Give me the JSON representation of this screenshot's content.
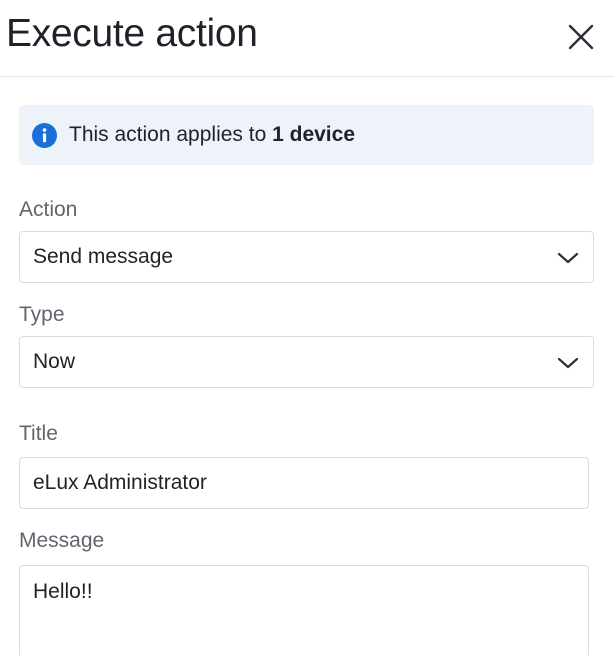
{
  "dialog": {
    "title": "Execute action",
    "close_icon": "close-icon"
  },
  "info_banner": {
    "icon": "info-icon",
    "text_prefix": "This action applies to ",
    "text_bold": "1 device"
  },
  "form": {
    "action": {
      "label": "Action",
      "value": "Send message"
    },
    "type": {
      "label": "Type",
      "value": "Now"
    },
    "title_field": {
      "label": "Title",
      "value": "eLux Administrator"
    },
    "message": {
      "label": "Message",
      "value": "Hello!!"
    }
  },
  "colors": {
    "info_icon": "#1a6fd6",
    "banner_bg": "#eef2f9",
    "border": "#d9dce1",
    "label_text": "#5f6670"
  }
}
